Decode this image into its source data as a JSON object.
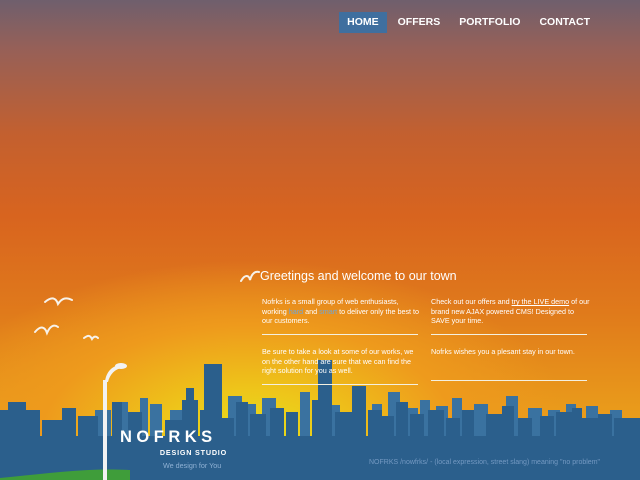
{
  "nav": {
    "items": [
      {
        "label": "HOME",
        "active": true
      },
      {
        "label": "OFFERS",
        "active": false
      },
      {
        "label": "PORTFOLIO",
        "active": false
      },
      {
        "label": "CONTACT",
        "active": false
      }
    ],
    "active_color": "#3f6f9f"
  },
  "content": {
    "greeting": "Greetings and welcome to our town",
    "intro": {
      "part1": "Nofrks is a small group of web enthusiasts, working",
      "word1": "hard",
      "part2": "and",
      "word2": "smart",
      "part3": "to deliver only the best to our customers."
    },
    "offers": {
      "part1": "Check out our offers and",
      "link": "try the LIVE demo",
      "part2": "of our brand new AJAX powered CMS! Designed to SAVE your time."
    },
    "portfolio_text": "Be sure to take a look at some of our works, we on the other hand are sure that we can find the right solution for you as well.",
    "wish_text": "Nofrks wishes you a plesant stay in our town."
  },
  "logo": {
    "name": "NOFRKS",
    "subtitle": "DESIGN STUDIO",
    "tagline": "We design for You"
  },
  "footer": {
    "note": "NOFRKS /nowfrks/ - (local expression, street slang) meaning \"no problem\""
  },
  "colors": {
    "skyline": "#2b5f8c",
    "skyline_back": "#3a72a0",
    "grass": "#3f9d3a",
    "sun": "#e6e21a",
    "sky_top": "#6f5f6d"
  },
  "icons": [
    "seagull-icon",
    "street-lamp-icon"
  ]
}
